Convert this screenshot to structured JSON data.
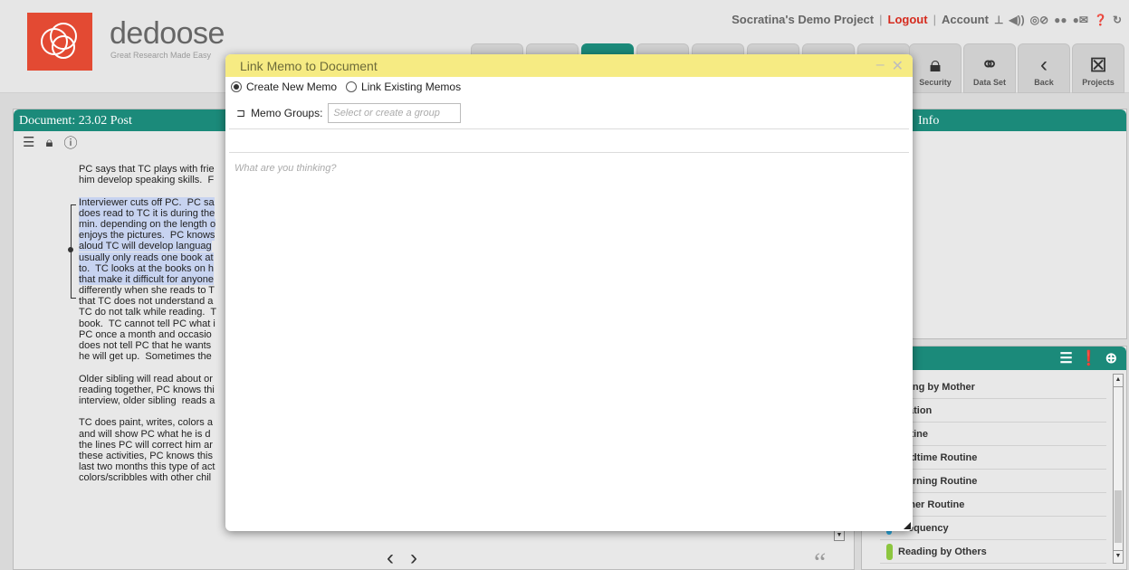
{
  "brand": {
    "name": "dedoose",
    "tagline": "Great Research Made Easy"
  },
  "topbar": {
    "project": "Socratina's Demo Project",
    "logout": "Logout",
    "account": "Account"
  },
  "navbuttons": [
    {
      "label": "Security",
      "icon": "lock-icon"
    },
    {
      "label": "Data Set",
      "icon": "binoculars-icon"
    },
    {
      "label": "Back",
      "icon": "chevron-left-icon"
    },
    {
      "label": "Projects",
      "icon": "projects-icon"
    }
  ],
  "document": {
    "title": "Document: 23.02 Post",
    "lines": [
      "PC says that TC plays with frie",
      "him develop speaking skills.  F",
      "",
      "Interviewer cuts off PC.  PC sa",
      "does read to TC it is during the",
      "min. depending on the length o",
      "enjoys the pictures.  PC knows",
      "aloud TC will develop languag",
      "usually only reads one book at",
      "to.  TC looks at the books on h",
      "that make it difficult for anyone",
      "differently when she reads to T",
      "that TC does not understand a",
      "TC do not talk while reading.  T",
      "book.  TC cannot tell PC what i",
      "PC once a month and occasio",
      "does not tell PC that he wants",
      "he will get up.  Sometimes the",
      "",
      "Older sibling will read about or",
      "reading together, PC knows thi",
      "interview, older sibling  reads a",
      "",
      "TC does paint, writes, colors a",
      "and will show PC what he is d",
      "the lines PC will correct him ar",
      "these activities, PC knows this",
      "last two months this type of act",
      "colors/scribbles with other chil"
    ]
  },
  "info": {
    "title": "Info"
  },
  "codes": {
    "items": [
      "ading by Mother",
      "uration",
      "outine",
      "Bedtime Routine",
      "Morning Routine",
      "Other Routine",
      "Frequency",
      "Reading by Others"
    ]
  },
  "modal": {
    "title": "Link Memo to Document",
    "radio_new": "Create New Memo",
    "radio_existing": "Link Existing Memos",
    "groups_label": "Memo Groups:",
    "groups_placeholder": "Select or create a group",
    "memo_title_value": "",
    "body_placeholder": "What are you thinking?"
  }
}
